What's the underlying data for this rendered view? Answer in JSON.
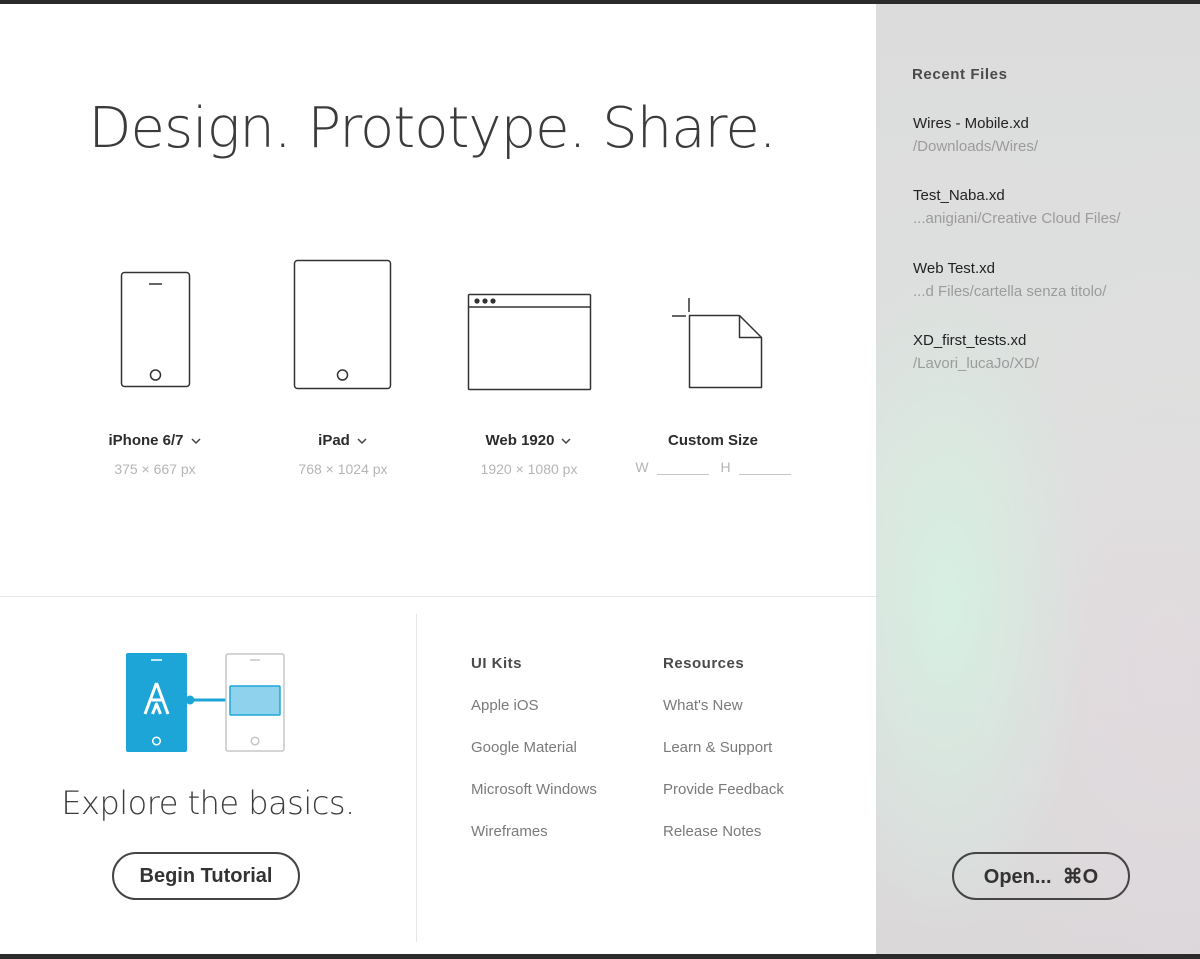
{
  "hero": {
    "title": "Design. Prototype. Share."
  },
  "presets": [
    {
      "label": "iPhone 6/7",
      "dimensions": "375 × 667 px",
      "icon": "iphone-icon"
    },
    {
      "label": "iPad",
      "dimensions": "768 × 1024 px",
      "icon": "ipad-icon"
    },
    {
      "label": "Web 1920",
      "dimensions": "1920 × 1080 px",
      "icon": "browser-window-icon"
    }
  ],
  "custom": {
    "label": "Custom Size",
    "w_label": "W",
    "h_label": "H",
    "icon": "new-file-icon"
  },
  "explore": {
    "title": "Explore the basics.",
    "button": "Begin Tutorial"
  },
  "ui_kits": {
    "heading": "UI Kits",
    "items": [
      "Apple iOS",
      "Google Material",
      "Microsoft Windows",
      "Wireframes"
    ]
  },
  "resources": {
    "heading": "Resources",
    "items": [
      "What's New",
      "Learn & Support",
      "Provide Feedback",
      "Release Notes"
    ]
  },
  "recent": {
    "heading": "Recent Files",
    "files": [
      {
        "name": "Wires - Mobile.xd",
        "path": "/Downloads/Wires/"
      },
      {
        "name": "Test_Naba.xd",
        "path": "...anigiani/Creative Cloud Files/"
      },
      {
        "name": "Web Test.xd",
        "path": "...d Files/cartella senza titolo/"
      },
      {
        "name": "XD_first_tests.xd",
        "path": "/Lavori_lucaJo/XD/"
      }
    ],
    "open_button": "Open...  ⌘O"
  },
  "colors": {
    "close": "#fc605c",
    "accent": "#1ea5d8",
    "accent_light": "#8fd2ee"
  }
}
